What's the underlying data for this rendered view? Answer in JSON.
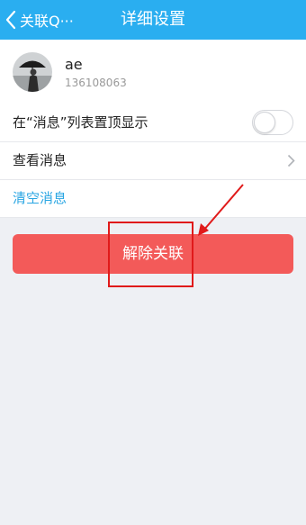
{
  "header": {
    "back_label": "关联Q···",
    "title": "详细设置",
    "back_icon": "chevron-left-icon"
  },
  "profile": {
    "name": "ae",
    "id": "136108063"
  },
  "settings": {
    "pin_label": "在“消息”列表置顶显示",
    "pin_enabled": false,
    "view_messages_label": "查看消息",
    "clear_messages_label": "清空消息"
  },
  "action": {
    "unlink_label": "解除关联"
  },
  "colors": {
    "header": "#2aaef0",
    "danger_button": "#f35a59",
    "link_text": "#2aa6e3",
    "annotation": "#e01a1a"
  }
}
